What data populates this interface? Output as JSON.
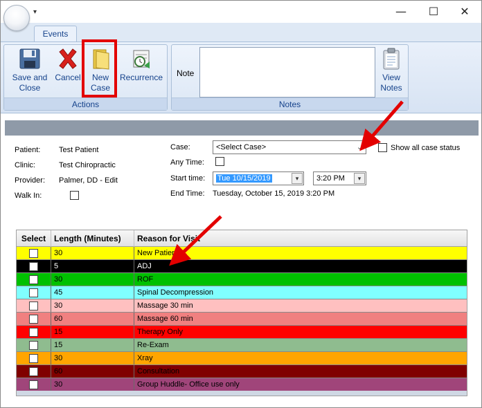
{
  "window": {
    "minimize": "—",
    "maximize": "☐",
    "close": "✕"
  },
  "ribbon": {
    "tab": "Events",
    "actions": {
      "label": "Actions",
      "save": "Save and Close",
      "save_l1": "Save and",
      "save_l2": "Close",
      "cancel": "Cancel",
      "newcase_l1": "New",
      "newcase_l2": "Case",
      "recurrence": "Recurrence"
    },
    "notes": {
      "label": "Notes",
      "note_label": "Note",
      "view_l1": "View",
      "view_l2": "Notes"
    }
  },
  "patient": {
    "patient_label": "Patient:",
    "patient_value": "Test Patient",
    "clinic_label": "Clinic:",
    "clinic_value": "Test Chiropractic",
    "provider_label": "Provider:",
    "provider_value": "Palmer, DD - Edit",
    "walkin_label": "Walk In:"
  },
  "event": {
    "case_label": "Case:",
    "case_value": "<Select Case>",
    "show_all": "Show all case status",
    "anytime_label": "Any Time:",
    "start_label": "Start time:",
    "start_date": "Tue 10/15/2019",
    "start_time": "3:20 PM",
    "end_label": "End Time:",
    "end_value": "Tuesday, October 15, 2019 3:20 PM"
  },
  "table": {
    "headers": {
      "select": "Select",
      "length": "Length (Minutes)",
      "reason": "Reason for Visit"
    },
    "rows": [
      {
        "length": "30",
        "reason": "New Patient",
        "bg": "#ffff00",
        "fg": "#000000"
      },
      {
        "length": "5",
        "reason": "ADJ",
        "bg": "#000000",
        "fg": "#ffffff"
      },
      {
        "length": "30",
        "reason": "ROF",
        "bg": "#00c000",
        "fg": "#000000"
      },
      {
        "length": "45",
        "reason": "Spinal Decompression",
        "bg": "#80ffff",
        "fg": "#000000"
      },
      {
        "length": "30",
        "reason": "Massage 30 min",
        "bg": "#ffc0c0",
        "fg": "#000000"
      },
      {
        "length": "60",
        "reason": "Massage 60 min",
        "bg": "#f08080",
        "fg": "#000000"
      },
      {
        "length": "15",
        "reason": "Therapy Only",
        "bg": "#ff0000",
        "fg": "#000000"
      },
      {
        "length": "15",
        "reason": "Re-Exam",
        "bg": "#8fbc8f",
        "fg": "#000000"
      },
      {
        "length": "30",
        "reason": "Xray",
        "bg": "#ffa500",
        "fg": "#000000"
      },
      {
        "length": "60",
        "reason": "Consultation",
        "bg": "#800000",
        "fg": "#000000"
      },
      {
        "length": "30",
        "reason": "Group Huddle- Office use only",
        "bg": "#a0457a",
        "fg": "#000000"
      }
    ]
  },
  "colors": {
    "highlight": "#e30000",
    "ribbon_text": "#15428b"
  }
}
